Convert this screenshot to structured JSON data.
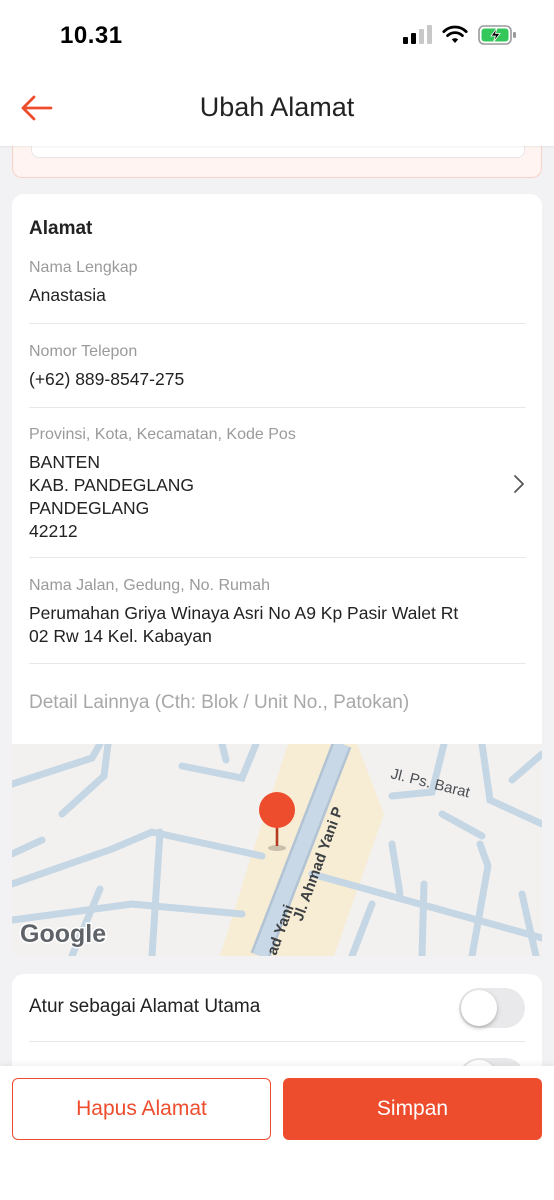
{
  "status": {
    "time": "10.31"
  },
  "header": {
    "title": "Ubah Alamat"
  },
  "address": {
    "section_title": "Alamat",
    "name_label": "Nama Lengkap",
    "name_value": "Anastasia",
    "phone_label": "Nomor Telepon",
    "phone_value": "(+62) 889-8547-275",
    "region_label": "Provinsi, Kota, Kecamatan, Kode Pos",
    "region_value": "BANTEN\nKAB. PANDEGLANG\nPANDEGLANG\n42212",
    "street_label": "Nama Jalan, Gedung, No. Rumah",
    "street_value": "Perumahan Griya Winaya Asri No A9 Kp Pasir Walet Rt\n02 Rw 14 Kel. Kabayan",
    "detail_placeholder": "Detail Lainnya (Cth: Blok / Unit No., Patokan)"
  },
  "map": {
    "road_main": "Jl. Ahmad Yani P",
    "road_side": "Jl. Ps. Barat",
    "road_bottom": "ad Yani",
    "logo": "Google",
    "pin_color": "#ee4d2d"
  },
  "toggles": {
    "primary_label": "Atur sebagai Alamat Utama",
    "primary_on": false
  },
  "actions": {
    "delete_label": "Hapus Alamat",
    "save_label": "Simpan"
  },
  "colors": {
    "accent": "#ee4d2d",
    "text": "#222222",
    "muted": "#9a9a9a"
  }
}
